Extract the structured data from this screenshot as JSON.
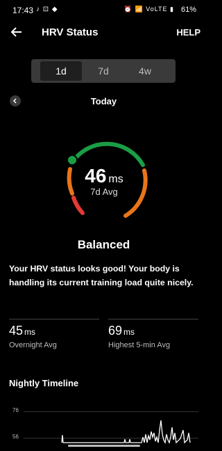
{
  "status_bar": {
    "time": "17:43",
    "left_icons": "♪ ⊡ ◆",
    "right_icons": "⏰ 📶 VoLTE ▮",
    "battery": "61%"
  },
  "app_bar": {
    "title": "HRV Status",
    "help": "HELP"
  },
  "segments": [
    {
      "label": "1d",
      "active": true
    },
    {
      "label": "7d",
      "active": false
    },
    {
      "label": "4w",
      "active": false
    }
  ],
  "date": {
    "label": "Today"
  },
  "gauge": {
    "value": "46",
    "unit": "ms",
    "caption": "7d Avg",
    "colors": {
      "red": "#e53935",
      "orange": "#e8751a",
      "green": "#1a9e45"
    }
  },
  "status": {
    "title": "Balanced",
    "description": "Your HRV status looks good! Your body is handling its current training load quite nicely."
  },
  "stats": [
    {
      "value": "45",
      "unit": "ms",
      "label": "Overnight Avg"
    },
    {
      "value": "69",
      "unit": "ms",
      "label": "Highest 5-min Avg"
    }
  ],
  "timeline": {
    "title": "Nightly Timeline",
    "ticks": [
      "76",
      "56"
    ]
  }
}
